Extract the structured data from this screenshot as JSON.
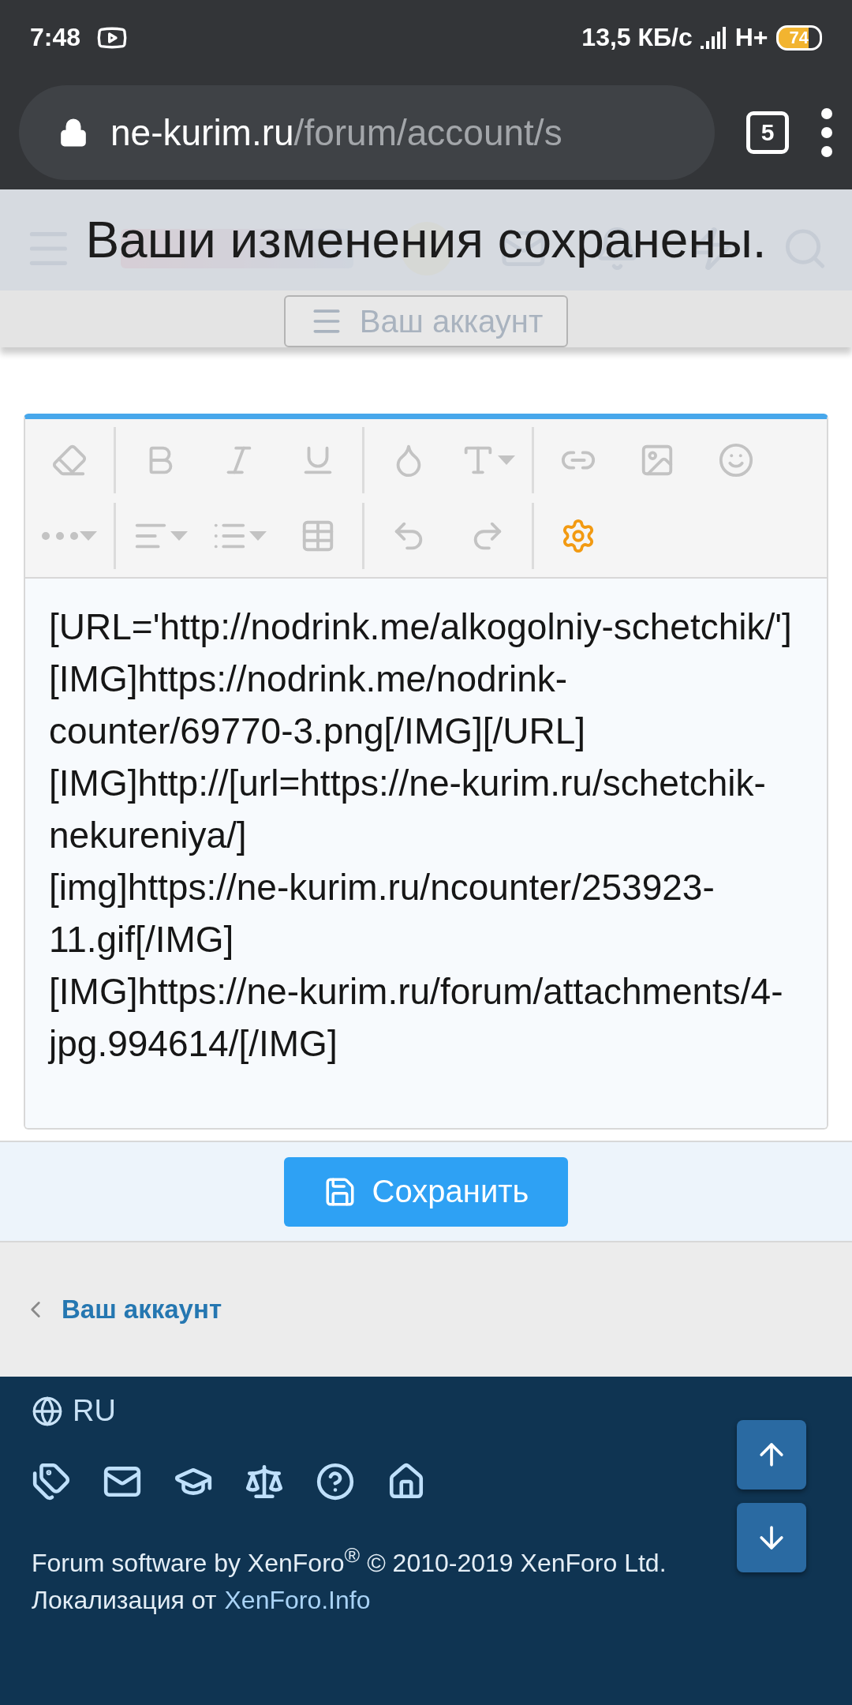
{
  "status_bar": {
    "time": "7:48",
    "speed": "13,5 КБ/с",
    "network": "H+",
    "battery": "74"
  },
  "address_bar": {
    "host": "ne-kurim.ru",
    "path": "/forum/account/s",
    "tab_count": "5"
  },
  "toast": {
    "message": "Ваши изменения сохранены."
  },
  "account_button": {
    "label": "Ваш аккаунт"
  },
  "editor": {
    "toolbar_rows": [
      [
        [
          {
            "kind": "eraser",
            "active": false
          }
        ],
        [
          {
            "kind": "bold",
            "active": false
          },
          {
            "kind": "italic",
            "active": false
          },
          {
            "kind": "underline",
            "active": false
          }
        ],
        [
          {
            "kind": "color",
            "active": false
          },
          {
            "kind": "font-size",
            "active": false
          }
        ],
        [
          {
            "kind": "link",
            "active": false
          },
          {
            "kind": "image",
            "active": false
          },
          {
            "kind": "smile",
            "active": false
          }
        ]
      ],
      [
        [
          {
            "kind": "more",
            "active": false
          }
        ],
        [
          {
            "kind": "align",
            "active": false
          },
          {
            "kind": "list",
            "active": false
          },
          {
            "kind": "table",
            "active": false
          }
        ],
        [
          {
            "kind": "undo",
            "active": false
          },
          {
            "kind": "redo",
            "active": false
          }
        ],
        [
          {
            "kind": "settings",
            "active": true
          }
        ]
      ]
    ],
    "lines": [
      "[URL='http://nodrink.me/alkogolniy-schetchik/'][IMG]https://nodrink.me/nodrink-counter/69770-3.png[/IMG][/URL]",
      "[IMG]http://[url=https://ne-kurim.ru/schetchik-nekureniya/]",
      "[img]https://ne-kurim.ru/ncounter/253923-11.gif[/IMG]",
      "[IMG]https://ne-kurim.ru/forum/attachments/4-jpg.994614/[/IMG]"
    ]
  },
  "save_button": {
    "label": "Сохранить"
  },
  "breadcrumb": {
    "label": "Ваш аккаунт"
  },
  "footer": {
    "language": "RU",
    "links": [
      {
        "kind": "tags"
      },
      {
        "kind": "mail"
      },
      {
        "kind": "education"
      },
      {
        "kind": "scale"
      },
      {
        "kind": "help"
      },
      {
        "kind": "home"
      }
    ],
    "copyright": "Forum software by XenForo$^{®}$ © 2010-2019 XenForo Ltd.",
    "localization": "Локализация от",
    "localization_link": "XenForo.Info"
  }
}
